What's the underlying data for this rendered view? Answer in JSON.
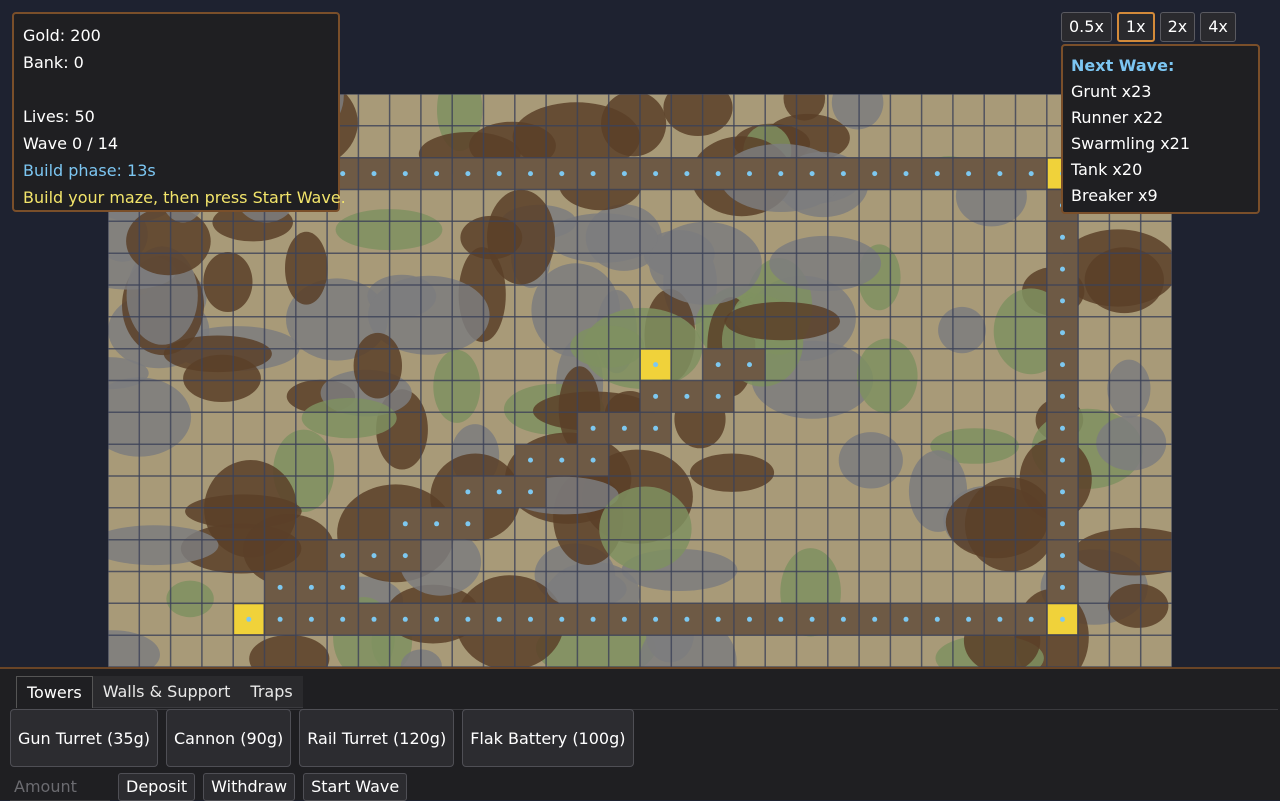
{
  "stats": {
    "gold": "Gold: 200",
    "bank": "Bank: 0",
    "lives": "Lives: 50",
    "wave": "Wave 0 / 14",
    "build_phase": "Build phase: 13s",
    "hint": "Build your maze, then press Start Wave."
  },
  "speed": {
    "options": [
      "0.5x",
      "1x",
      "2x",
      "4x"
    ],
    "active": "1x"
  },
  "next_wave": {
    "title": "Next Wave:",
    "enemies": [
      "Grunt x23",
      "Runner x22",
      "Swarmling x21",
      "Tank x20",
      "Breaker x9"
    ]
  },
  "tabs": [
    "Towers",
    "Walls & Support",
    "Traps"
  ],
  "active_tab": "Towers",
  "buy_buttons": [
    "Gun Turret (35g)",
    "Cannon (90g)",
    "Rail Turret (120g)",
    "Flak Battery (100g)"
  ],
  "amount": {
    "placeholder": "Amount",
    "value": ""
  },
  "actions": {
    "deposit": "Deposit",
    "withdraw": "Withdraw",
    "start_wave": "Start Wave"
  },
  "map": {
    "grid_cols": 34,
    "grid_rows": 18,
    "colors": {
      "sand": "#a89a78",
      "mud": "#5a4028",
      "stone": "#7c7c7e",
      "moss": "#7f9060",
      "grid_line": "#3c4258",
      "path": "#6e5a45",
      "path_dot": "#7dc8f0",
      "marker": "#f0d23a"
    },
    "path_cells": [
      [
        7,
        2
      ],
      [
        8,
        2
      ],
      [
        9,
        2
      ],
      [
        10,
        2
      ],
      [
        11,
        2
      ],
      [
        12,
        2
      ],
      [
        13,
        2
      ],
      [
        14,
        2
      ],
      [
        15,
        2
      ],
      [
        16,
        2
      ],
      [
        17,
        2
      ],
      [
        18,
        2
      ],
      [
        19,
        2
      ],
      [
        20,
        2
      ],
      [
        21,
        2
      ],
      [
        22,
        2
      ],
      [
        23,
        2
      ],
      [
        24,
        2
      ],
      [
        25,
        2
      ],
      [
        26,
        2
      ],
      [
        27,
        2
      ],
      [
        28,
        2
      ],
      [
        29,
        2
      ],
      [
        30,
        2
      ],
      [
        30,
        3
      ],
      [
        30,
        4
      ],
      [
        30,
        5
      ],
      [
        30,
        6
      ],
      [
        30,
        7
      ],
      [
        30,
        8
      ],
      [
        30,
        9
      ],
      [
        30,
        10
      ],
      [
        30,
        11
      ],
      [
        30,
        12
      ],
      [
        30,
        13
      ],
      [
        30,
        14
      ],
      [
        30,
        15
      ],
      [
        30,
        16
      ],
      [
        4,
        16
      ],
      [
        5,
        16
      ],
      [
        6,
        16
      ],
      [
        7,
        16
      ],
      [
        8,
        16
      ],
      [
        9,
        16
      ],
      [
        10,
        16
      ],
      [
        11,
        16
      ],
      [
        12,
        16
      ],
      [
        13,
        16
      ],
      [
        14,
        16
      ],
      [
        15,
        16
      ],
      [
        16,
        16
      ],
      [
        17,
        16
      ],
      [
        18,
        16
      ],
      [
        19,
        16
      ],
      [
        20,
        16
      ],
      [
        21,
        16
      ],
      [
        22,
        16
      ],
      [
        23,
        16
      ],
      [
        24,
        16
      ],
      [
        25,
        16
      ],
      [
        26,
        16
      ],
      [
        27,
        16
      ],
      [
        28,
        16
      ],
      [
        29,
        16
      ],
      [
        5,
        15
      ],
      [
        6,
        15
      ],
      [
        7,
        15
      ],
      [
        7,
        14
      ],
      [
        8,
        14
      ],
      [
        9,
        14
      ],
      [
        9,
        13
      ],
      [
        10,
        13
      ],
      [
        11,
        13
      ],
      [
        11,
        12
      ],
      [
        12,
        12
      ],
      [
        13,
        12
      ],
      [
        13,
        11
      ],
      [
        14,
        11
      ],
      [
        15,
        11
      ],
      [
        15,
        10
      ],
      [
        16,
        10
      ],
      [
        17,
        10
      ],
      [
        17,
        9
      ],
      [
        18,
        9
      ],
      [
        19,
        9
      ],
      [
        19,
        8
      ],
      [
        20,
        8
      ]
    ],
    "markers": [
      [
        30,
        2
      ],
      [
        17,
        8
      ],
      [
        4,
        16
      ],
      [
        30,
        16
      ]
    ]
  }
}
